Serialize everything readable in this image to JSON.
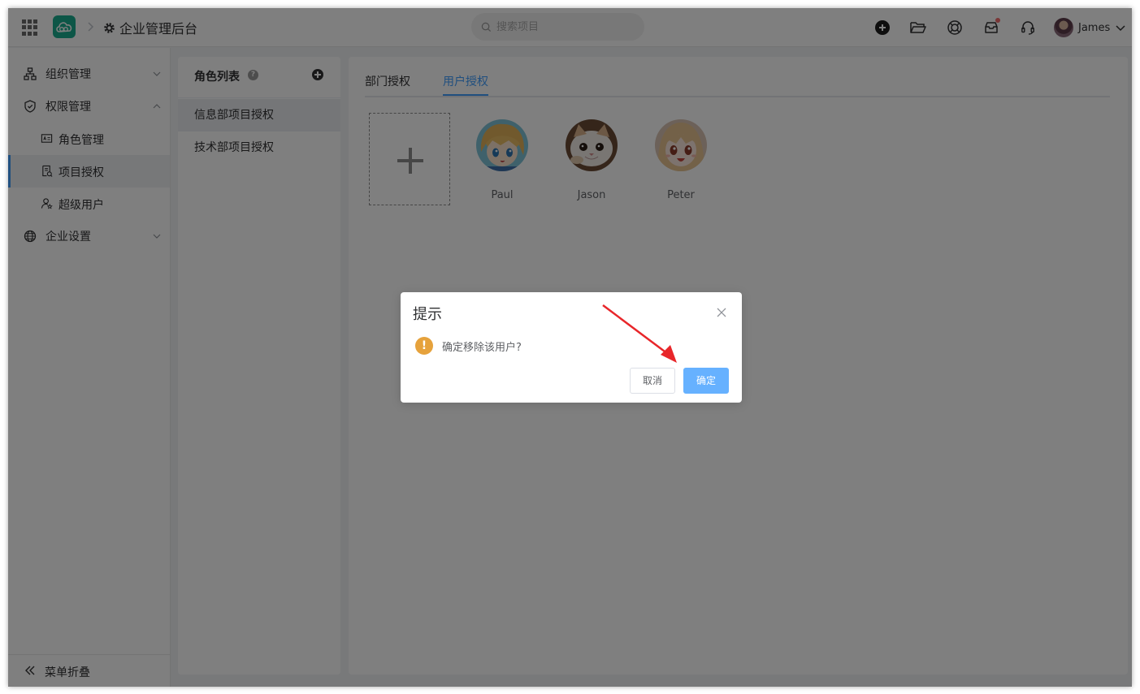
{
  "header": {
    "app_title": "企业管理后台",
    "search_placeholder": "搜索项目",
    "user_name": "James"
  },
  "sidebar": {
    "items": [
      {
        "label": "组织管理",
        "icon": "org-tree-icon",
        "expanded": false
      },
      {
        "label": "权限管理",
        "icon": "shield-icon",
        "expanded": true,
        "children": [
          {
            "label": "角色管理",
            "icon": "id-card-icon"
          },
          {
            "label": "项目授权",
            "icon": "document-check-icon",
            "active": true
          },
          {
            "label": "超级用户",
            "icon": "user-star-icon"
          }
        ]
      },
      {
        "label": "企业设置",
        "icon": "globe-icon",
        "expanded": false
      }
    ],
    "collapse_label": "菜单折叠"
  },
  "role_panel": {
    "title": "角色列表",
    "help": "?",
    "roles": [
      {
        "label": "信息部项目授权",
        "active": true
      },
      {
        "label": "技术部项目授权",
        "active": false
      }
    ]
  },
  "main": {
    "tabs": [
      {
        "label": "部门授权",
        "active": false
      },
      {
        "label": "用户授权",
        "active": true
      }
    ],
    "users": [
      {
        "name": "Paul"
      },
      {
        "name": "Jason"
      },
      {
        "name": "Peter"
      }
    ]
  },
  "dialog": {
    "title": "提示",
    "warn_symbol": "!",
    "message": "确定移除该用户?",
    "cancel_label": "取消",
    "confirm_label": "确定"
  },
  "colors": {
    "primary": "#409eff",
    "confirm_button": "#66b1ff",
    "warning": "#e6a23c",
    "logo": "#1aad8f",
    "annotation_arrow": "#e8262a"
  }
}
